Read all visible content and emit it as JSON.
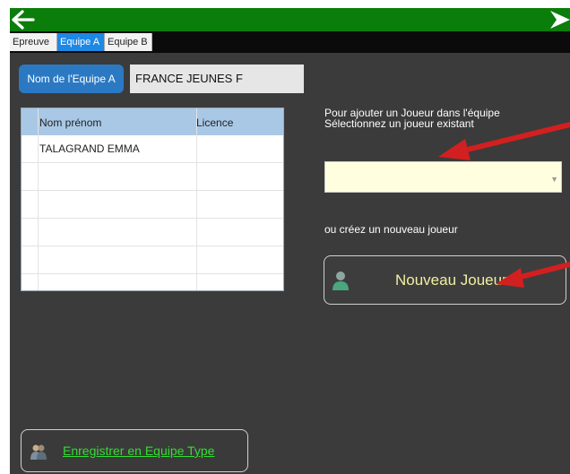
{
  "tabs": [
    {
      "label": "Epreuve",
      "active": false
    },
    {
      "label": "Equipe A",
      "active": true
    },
    {
      "label": "Equipe B",
      "active": false
    }
  ],
  "team": {
    "name_label": "Nom de l'Equipe A",
    "name_value": "FRANCE JEUNES F"
  },
  "table": {
    "headers": [
      "Nom prénom",
      "Licence"
    ],
    "rows": [
      [
        "TALAGRAND EMMA",
        ""
      ],
      [
        "",
        ""
      ],
      [
        "",
        ""
      ],
      [
        "",
        ""
      ],
      [
        "",
        ""
      ],
      [
        "",
        ""
      ]
    ]
  },
  "right_panel": {
    "instruction_line1": "Pour ajouter un Joueur dans l'équipe",
    "instruction_line2": "Sélectionnez un joueur existant",
    "select_value": "",
    "or_text": "ou créez un nouveau joueur",
    "new_player_label": "Nouveau Joueur"
  },
  "footer": {
    "save_team_label": "Enregistrer en Equipe Type"
  },
  "icons": {
    "back": "arrow-left-icon",
    "forward": "arrow-right-icon",
    "new_player": "person-icon",
    "save_team": "team-icon"
  },
  "colors": {
    "topbar": "#0a7d0a",
    "tab_active": "#1e88e5",
    "panel_bg": "#3b3b3b",
    "accent_button": "#2b79c2",
    "table_header": "#a9c8e6",
    "select_bg": "#ffffe0",
    "new_player_text": "#f0f0a0",
    "save_text": "#33dd33",
    "annotation_arrow": "#d21f1f"
  }
}
